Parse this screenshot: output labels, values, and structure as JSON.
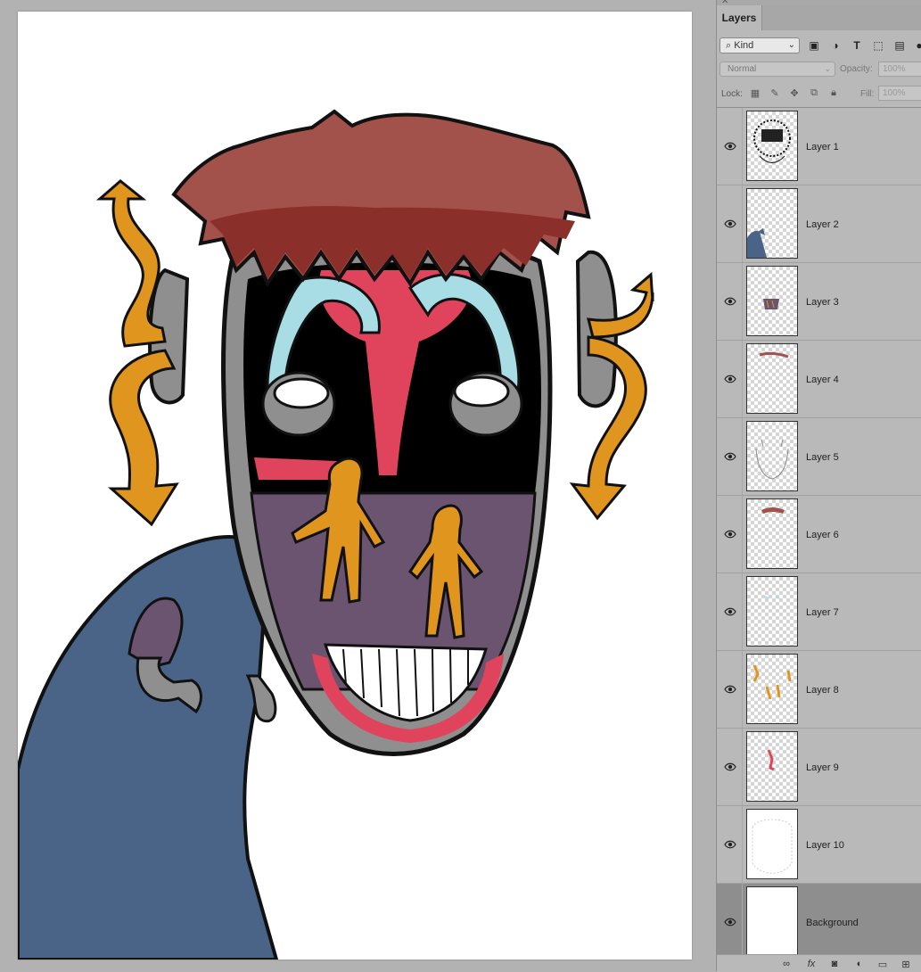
{
  "panel": {
    "tab_label": "Layers",
    "kind_filter": "Kind",
    "blend_mode": "Normal",
    "opacity_label": "Opacity:",
    "opacity_value": "100%",
    "lock_label": "Lock:",
    "fill_label": "Fill:",
    "fill_value": "100%"
  },
  "layers": [
    {
      "name": "Layer 1",
      "visible": true
    },
    {
      "name": "Layer 2",
      "visible": true
    },
    {
      "name": "Layer 3",
      "visible": true
    },
    {
      "name": "Layer 4",
      "visible": true
    },
    {
      "name": "Layer 5",
      "visible": true
    },
    {
      "name": "Layer 6",
      "visible": true
    },
    {
      "name": "Layer 7",
      "visible": true
    },
    {
      "name": "Layer 8",
      "visible": true
    },
    {
      "name": "Layer 9",
      "visible": true
    },
    {
      "name": "Layer 10",
      "visible": true
    },
    {
      "name": "Background",
      "visible": true,
      "selected": true
    }
  ],
  "colors": {
    "panel_bg": "#b9b9b9",
    "selected_row": "#8e8e8e",
    "hair": "#a3524b",
    "hair_dark": "#8a2f2a",
    "body_blue": "#4a6487",
    "arrow_orange": "#e0961e",
    "face_gray": "#8f8f8f",
    "mouth_purple": "#6b5470",
    "brain_pink": "#e0435c",
    "light_blue": "#a9dde6"
  },
  "icons": {
    "visibility": "eye-icon",
    "filter": "search-icon"
  }
}
